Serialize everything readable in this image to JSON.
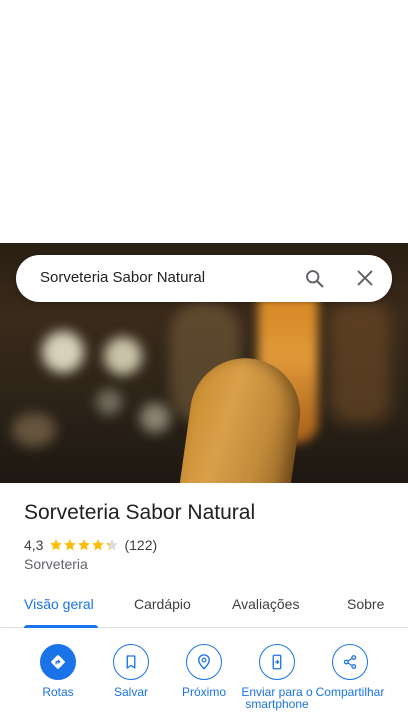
{
  "search": {
    "query": "Sorveteria Sabor Natural"
  },
  "place": {
    "name": "Sorveteria Sabor Natural",
    "rating": "4,3",
    "rating_value": 4.3,
    "review_count": "(122)",
    "category": "Sorveteria"
  },
  "tabs": [
    {
      "label": "Visão geral",
      "active": true
    },
    {
      "label": "Cardápio",
      "active": false
    },
    {
      "label": "Avaliações",
      "active": false
    },
    {
      "label": "Sobre",
      "active": false
    }
  ],
  "actions": [
    {
      "label": "Rotas",
      "icon": "directions-icon"
    },
    {
      "label": "Salvar",
      "icon": "bookmark-icon"
    },
    {
      "label": "Próximo",
      "icon": "nearby-icon"
    },
    {
      "label": "Enviar para o smartphone",
      "icon": "send-to-phone-icon"
    },
    {
      "label": "Compartilhar",
      "icon": "share-icon"
    }
  ],
  "colors": {
    "accent": "#1a73e8",
    "star": "#fbbc04",
    "text": "#202124"
  }
}
